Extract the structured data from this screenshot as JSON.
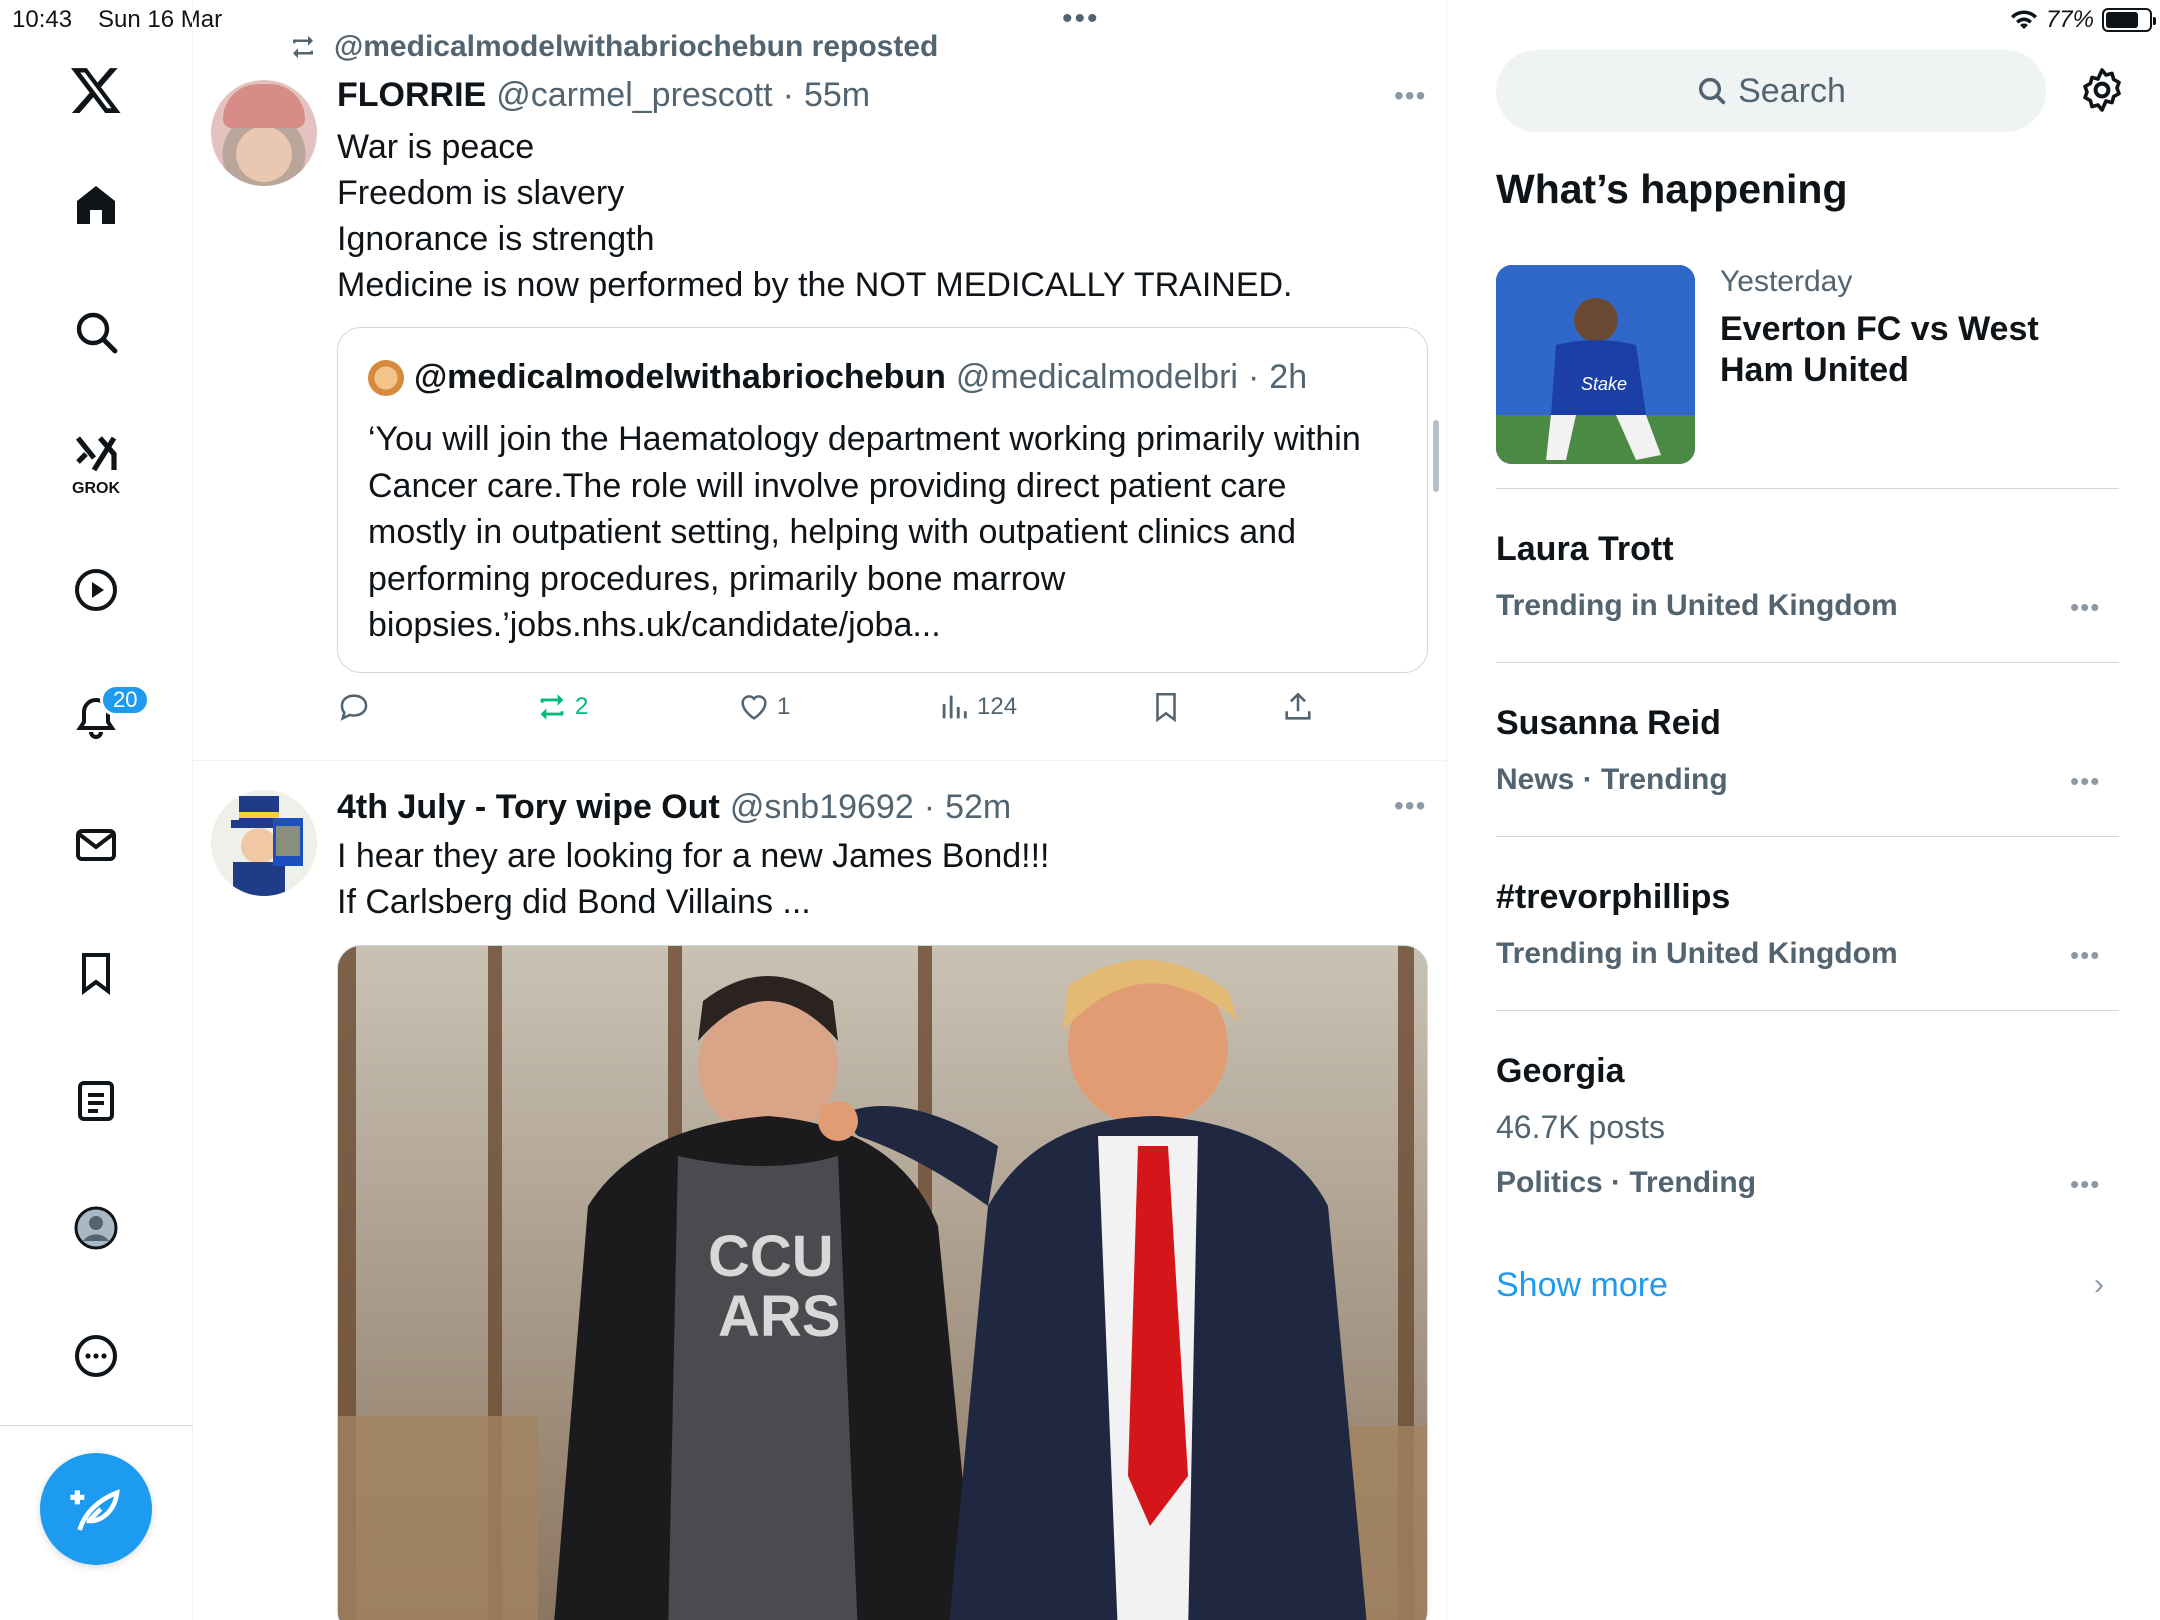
{
  "status": {
    "time": "10:43",
    "date": "Sun 16 Mar",
    "battery": "77%",
    "battery_level": 0.77
  },
  "nav": {
    "grok_label": "GROK",
    "notifications_badge": "20"
  },
  "tweet1": {
    "repost_text": "@medicalmodelwithabriochebun reposted",
    "name": "FLORRIE",
    "handle": "@carmel_prescott",
    "sep": "·",
    "time": "55m",
    "lines": [
      "War is peace",
      "Freedom is slavery",
      "Ignorance is strength",
      "Medicine is now performed by the NOT MEDICALLY TRAINED."
    ],
    "quote": {
      "name": "@medicalmodelwithabriochebun",
      "handle": "@medicalmodelbri",
      "sep": "·",
      "time": "2h",
      "lines": [
        "‘You will join the Haematology department working primarily within",
        "Cancer care.The role will involve providing direct patient care",
        "mostly in outpatient setting, helping with outpatient clinics and",
        "performing procedures, primarily bone marrow",
        "biopsies.’jobs.nhs.uk/candidate/joba..."
      ]
    },
    "actions": {
      "reposts": "2",
      "likes": "1",
      "views": "124"
    }
  },
  "tweet2": {
    "name": "4th July - Tory wipe Out",
    "handle": "@snb19692",
    "sep": "·",
    "time": "52m",
    "lines": [
      "I hear they are looking for a new James Bond!!!",
      "If Carlsberg did Bond Villains ..."
    ],
    "photo_shirt_text": [
      "CCU",
      "ARS"
    ]
  },
  "sidebar": {
    "search_placeholder": "Search",
    "title": "What’s happening",
    "event": {
      "time": "Yesterday",
      "title": "Everton FC vs West Ham United"
    },
    "trends": [
      {
        "name": "Laura Trott",
        "sub": "Trending in United Kingdom"
      },
      {
        "name": "Susanna Reid",
        "sub": "News · Trending"
      },
      {
        "name": "#trevorphillips",
        "sub": "Trending in United Kingdom"
      },
      {
        "name": "Georgia",
        "posts": "46.7K posts",
        "sub": "Politics · Trending"
      }
    ],
    "show_more": "Show more"
  },
  "colors": {
    "accent": "#1d9bf0",
    "repost_green": "#00ba7c",
    "muted": "#536471"
  }
}
